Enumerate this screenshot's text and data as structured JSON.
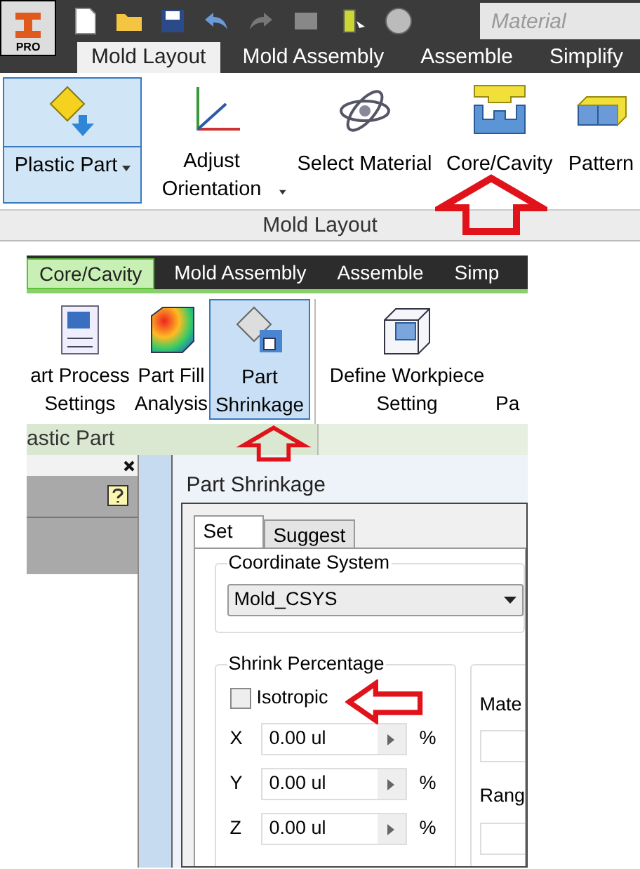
{
  "top": {
    "app_button": {
      "label": "PRO"
    },
    "material_field": {
      "placeholder": "Material"
    },
    "tabs": [
      {
        "label": "Mold Layout",
        "selected": true
      },
      {
        "label": "Mold Assembly",
        "selected": false
      },
      {
        "label": "Assemble",
        "selected": false
      },
      {
        "label": "Simplify",
        "selected": false
      }
    ],
    "buttons": [
      {
        "label": "Plastic Part",
        "selected": true,
        "has_menu": true
      },
      {
        "label": "Adjust Orientation",
        "selected": false,
        "has_menu": true
      },
      {
        "label": "Select Material",
        "selected": false,
        "has_menu": false
      },
      {
        "label": "Core/Cavity",
        "selected": false,
        "has_menu": false
      },
      {
        "label": "Pattern",
        "selected": false,
        "has_menu": false
      }
    ],
    "panel_label": "Mold Layout"
  },
  "bottom": {
    "tabs": [
      {
        "label": "Core/Cavity",
        "selected": true
      },
      {
        "label": "Mold Assembly",
        "selected": false
      },
      {
        "label": "Assemble",
        "selected": false
      },
      {
        "label": "Simp",
        "selected": false
      }
    ],
    "buttons": [
      {
        "label": "art Process Settings",
        "selected": false
      },
      {
        "label": "Part Fill Analysis",
        "selected": false
      },
      {
        "label": "Part Shrinkage",
        "selected": true
      },
      {
        "label": "Define Workpiece Setting",
        "selected": false
      },
      {
        "label": "Pa",
        "selected": false
      }
    ],
    "panel_label": "astic Part",
    "dialog": {
      "title": "Part Shrinkage",
      "tabs": [
        {
          "label": "Set",
          "selected": true
        },
        {
          "label": "Suggest",
          "selected": false
        }
      ],
      "coordinate_system": {
        "label": "Coordinate System",
        "value": "Mold_CSYS"
      },
      "shrink": {
        "label": "Shrink Percentage",
        "isotropic": {
          "label": "Isotropic",
          "checked": false
        },
        "axes": [
          {
            "label": "X",
            "value": "0.00 ul",
            "unit": "%"
          },
          {
            "label": "Y",
            "value": "0.00 ul",
            "unit": "%"
          },
          {
            "label": "Z",
            "value": "0.00 ul",
            "unit": "%"
          }
        ]
      },
      "side_labels": [
        "Mate",
        "Rang"
      ]
    }
  }
}
